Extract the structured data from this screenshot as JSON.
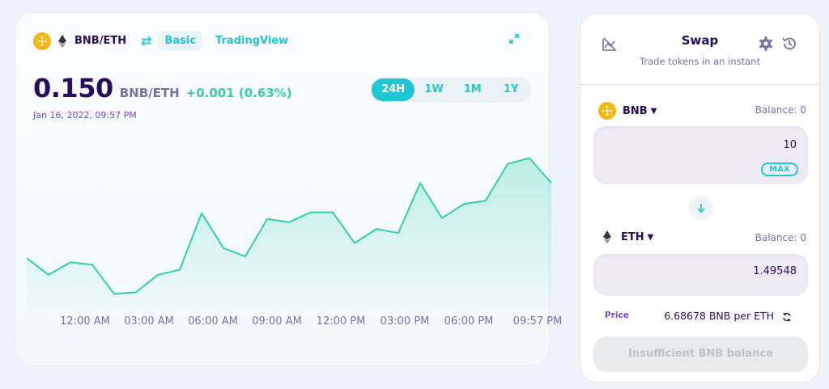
{
  "chart_card": {
    "pair": "BNB/ETH",
    "modes": [
      "Basic",
      "TradingView"
    ],
    "price": "0.150",
    "price_pair": "BNB/ETH",
    "change": "+0.001 (0.63%)",
    "date": "Jan 16, 2022, 09:57 PM",
    "ranges": [
      "24H",
      "1W",
      "1M",
      "1Y"
    ],
    "active_range": "24H",
    "icons": {
      "base": "bnb-coin-icon",
      "quote": "eth-coin-icon",
      "switch": "swap-arrows-icon",
      "expand": "expand-icon"
    }
  },
  "chart_data": {
    "type": "area",
    "x": [
      "10:00 PM",
      "11:00 PM",
      "12:00 AM",
      "01:00 AM",
      "02:00 AM",
      "03:00 AM",
      "04:00 AM",
      "05:00 AM",
      "06:00 AM",
      "07:00 AM",
      "08:00 AM",
      "09:00 AM",
      "10:00 AM",
      "11:00 AM",
      "12:00 PM",
      "01:00 PM",
      "02:00 PM",
      "03:00 PM",
      "04:00 PM",
      "05:00 PM",
      "06:00 PM",
      "07:00 PM",
      "08:00 PM",
      "09:00 PM",
      "09:57 PM"
    ],
    "values": [
      0.1465,
      0.1445,
      0.146,
      0.1457,
      0.1422,
      0.1424,
      0.1445,
      0.1451,
      0.1519,
      0.1477,
      0.1467,
      0.1512,
      0.1508,
      0.152,
      0.152,
      0.1483,
      0.15,
      0.1495,
      0.1555,
      0.1513,
      0.153,
      0.1534,
      0.1578,
      0.1585,
      0.1555
    ],
    "tick_labels": [
      "12:00 AM",
      "03:00 AM",
      "06:00 AM",
      "09:00 AM",
      "12:00 PM",
      "03:00 PM",
      "06:00 PM",
      "09:57 PM"
    ],
    "color": "#31d0aa",
    "grid": false
  },
  "swap": {
    "title": "Swap",
    "subtitle": "Trade tokens in an instant",
    "from_token": "BNB",
    "from_balance": "Balance: 0",
    "from_amount": "10",
    "max_label": "MAX",
    "to_token": "ETH",
    "to_balance": "Balance: 0",
    "to_amount": "1.49548",
    "price_label": "Price",
    "price_text": "6.68678 BNB per ETH",
    "cta": "Insufficient BNB balance",
    "icons": {
      "chart_toggle": "chart-disabled-icon",
      "settings": "gear-icon",
      "history": "history-icon",
      "switch": "arrow-down-icon",
      "refresh": "refresh-icon"
    }
  },
  "colors": {
    "primary": "#1fc7d4",
    "text": "#280d5f",
    "secondary": "#7a6eaa",
    "success": "#31d0aa",
    "bnb": "#f0b90b"
  }
}
